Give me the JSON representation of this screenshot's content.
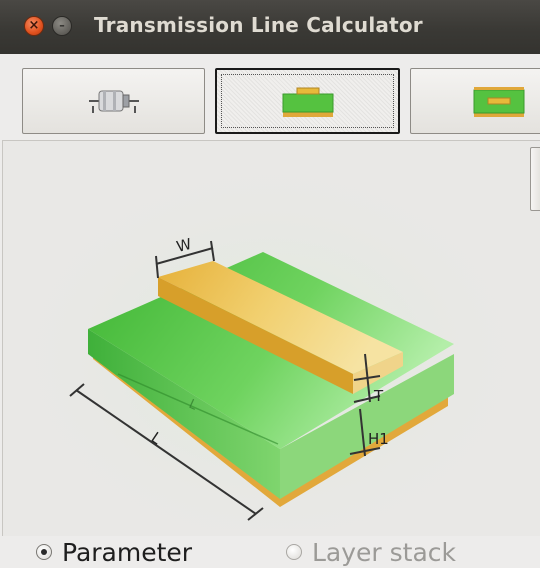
{
  "window": {
    "title": "Transmission Line Calculator",
    "close_glyph": "×",
    "minimize_glyph": "–"
  },
  "tabs": [
    {
      "name": "coaxial",
      "icon": "coax-cable-icon",
      "selected": false
    },
    {
      "name": "microstrip",
      "icon": "microstrip-icon",
      "selected": true
    },
    {
      "name": "stripline",
      "icon": "stripline-icon",
      "selected": false
    }
  ],
  "diagram": {
    "labels": {
      "width": "W",
      "thickness": "T",
      "height": "H1",
      "length": "L",
      "length_inner": "L"
    },
    "colors": {
      "substrate": "#4cc33e",
      "conductor": "#e8b93a",
      "ground": "#e0a83a"
    }
  },
  "options": {
    "parameter": {
      "label": "Parameter",
      "selected": true
    },
    "layer_stack": {
      "label": "Layer stack",
      "selected": false,
      "enabled": false
    }
  }
}
